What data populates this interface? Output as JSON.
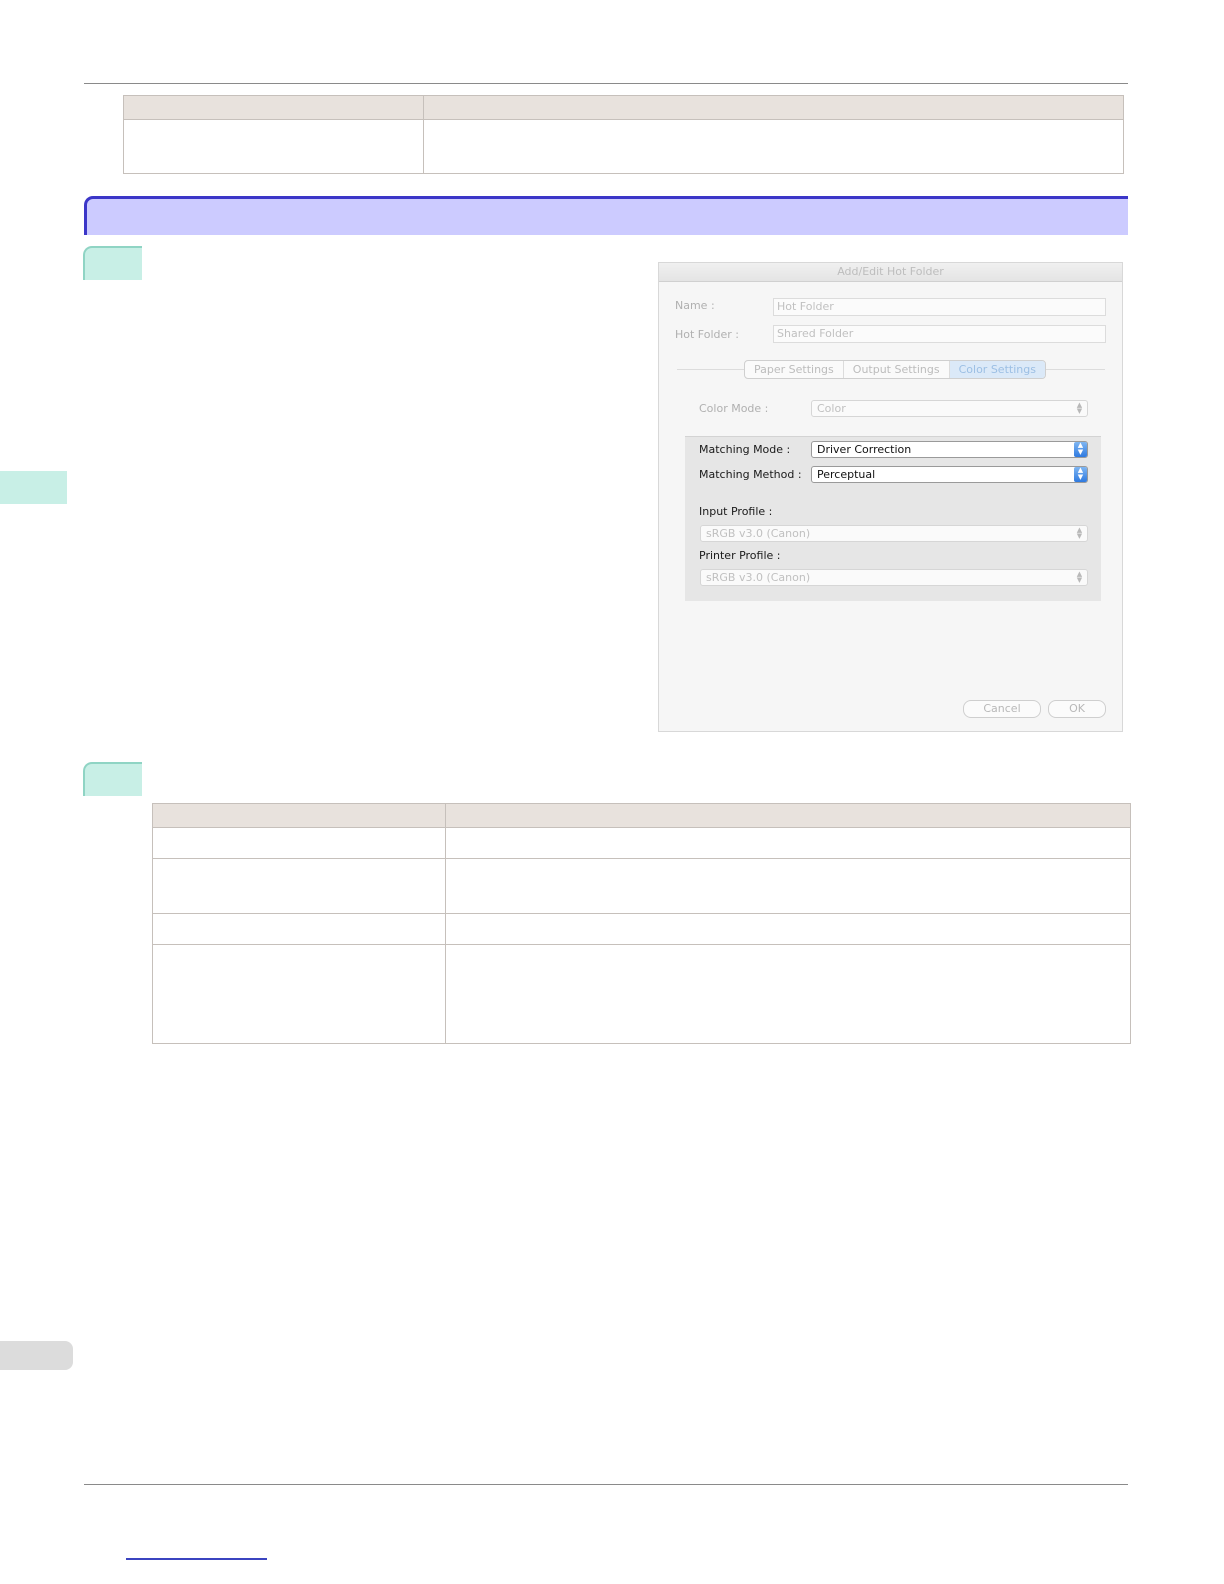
{
  "dialog": {
    "title": "Add/Edit Hot Folder",
    "name_label": "Name :",
    "name_value": "Hot Folder",
    "hot_folder_label": "Hot Folder :",
    "hot_folder_value": "Shared Folder",
    "tabs": [
      "Paper Settings",
      "Output Settings",
      "Color Settings"
    ],
    "active_tab": "Color Settings",
    "color_mode_label": "Color Mode :",
    "color_mode_value": "Color",
    "matching_mode_label": "Matching Mode :",
    "matching_mode_value": "Driver Correction",
    "matching_method_label": "Matching Method :",
    "matching_method_value": "Perceptual",
    "input_profile_label": "Input Profile :",
    "input_profile_value": "sRGB v3.0 (Canon)",
    "printer_profile_label": "Printer Profile :",
    "printer_profile_value": "sRGB v3.0 (Canon)",
    "cancel_label": "Cancel",
    "ok_label": "OK"
  },
  "colors": {
    "section_bar": "#cccbff",
    "section_border": "#3b36c8",
    "step_badge": "#c8efe6",
    "table_header": "#e8e2dd",
    "active_select": "#2f7ae0"
  }
}
